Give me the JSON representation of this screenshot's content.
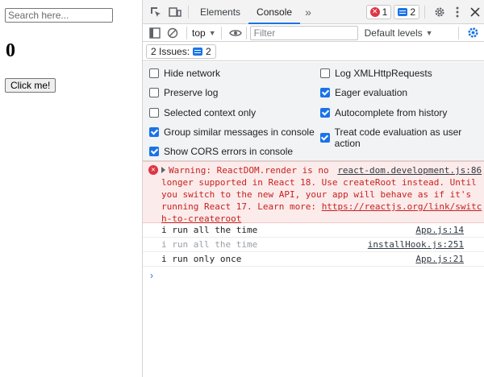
{
  "app": {
    "search_placeholder": "Search here...",
    "counter": "0",
    "button_label": "Click me!"
  },
  "devtools": {
    "tabs": {
      "elements": "Elements",
      "console": "Console"
    },
    "error_count": "1",
    "message_count": "2",
    "context": "top",
    "filter_placeholder": "Filter",
    "levels": "Default levels",
    "issues_label": "2 Issues:",
    "issues_count": "2",
    "settings": [
      {
        "label": "Hide network",
        "checked": false
      },
      {
        "label": "Log XMLHttpRequests",
        "checked": false
      },
      {
        "label": "Preserve log",
        "checked": false
      },
      {
        "label": "Eager evaluation",
        "checked": true
      },
      {
        "label": "Selected context only",
        "checked": false
      },
      {
        "label": "Autocomplete from history",
        "checked": true
      },
      {
        "label": "Group similar messages in console",
        "checked": true
      },
      {
        "label": "Treat code evaluation as user action",
        "checked": true
      },
      {
        "label": "Show CORS errors in console",
        "checked": true
      }
    ],
    "warning": {
      "text_part1": "Warning: ReactDOM.render is no",
      "source": "react-dom.development.js:86",
      "text_rest": "longer supported in React 18. Use createRoot instead. Until you switch to the new API, your app will behave as if it's running React 17. Learn more: ",
      "link": "https://reactjs.org/link/switch-to-createroot"
    },
    "logs": [
      {
        "text": "i run all the time",
        "source": "App.js:14",
        "dim": false
      },
      {
        "text": "i run all the time",
        "source": "installHook.js:251",
        "dim": true
      },
      {
        "text": "i run only once",
        "source": "App.js:21",
        "dim": false
      }
    ],
    "prompt": "›"
  },
  "colors": {
    "accent": "#1a73e8",
    "error": "#dc3545",
    "warning_bg": "#fcebeb",
    "warning_text": "#c5221f"
  }
}
